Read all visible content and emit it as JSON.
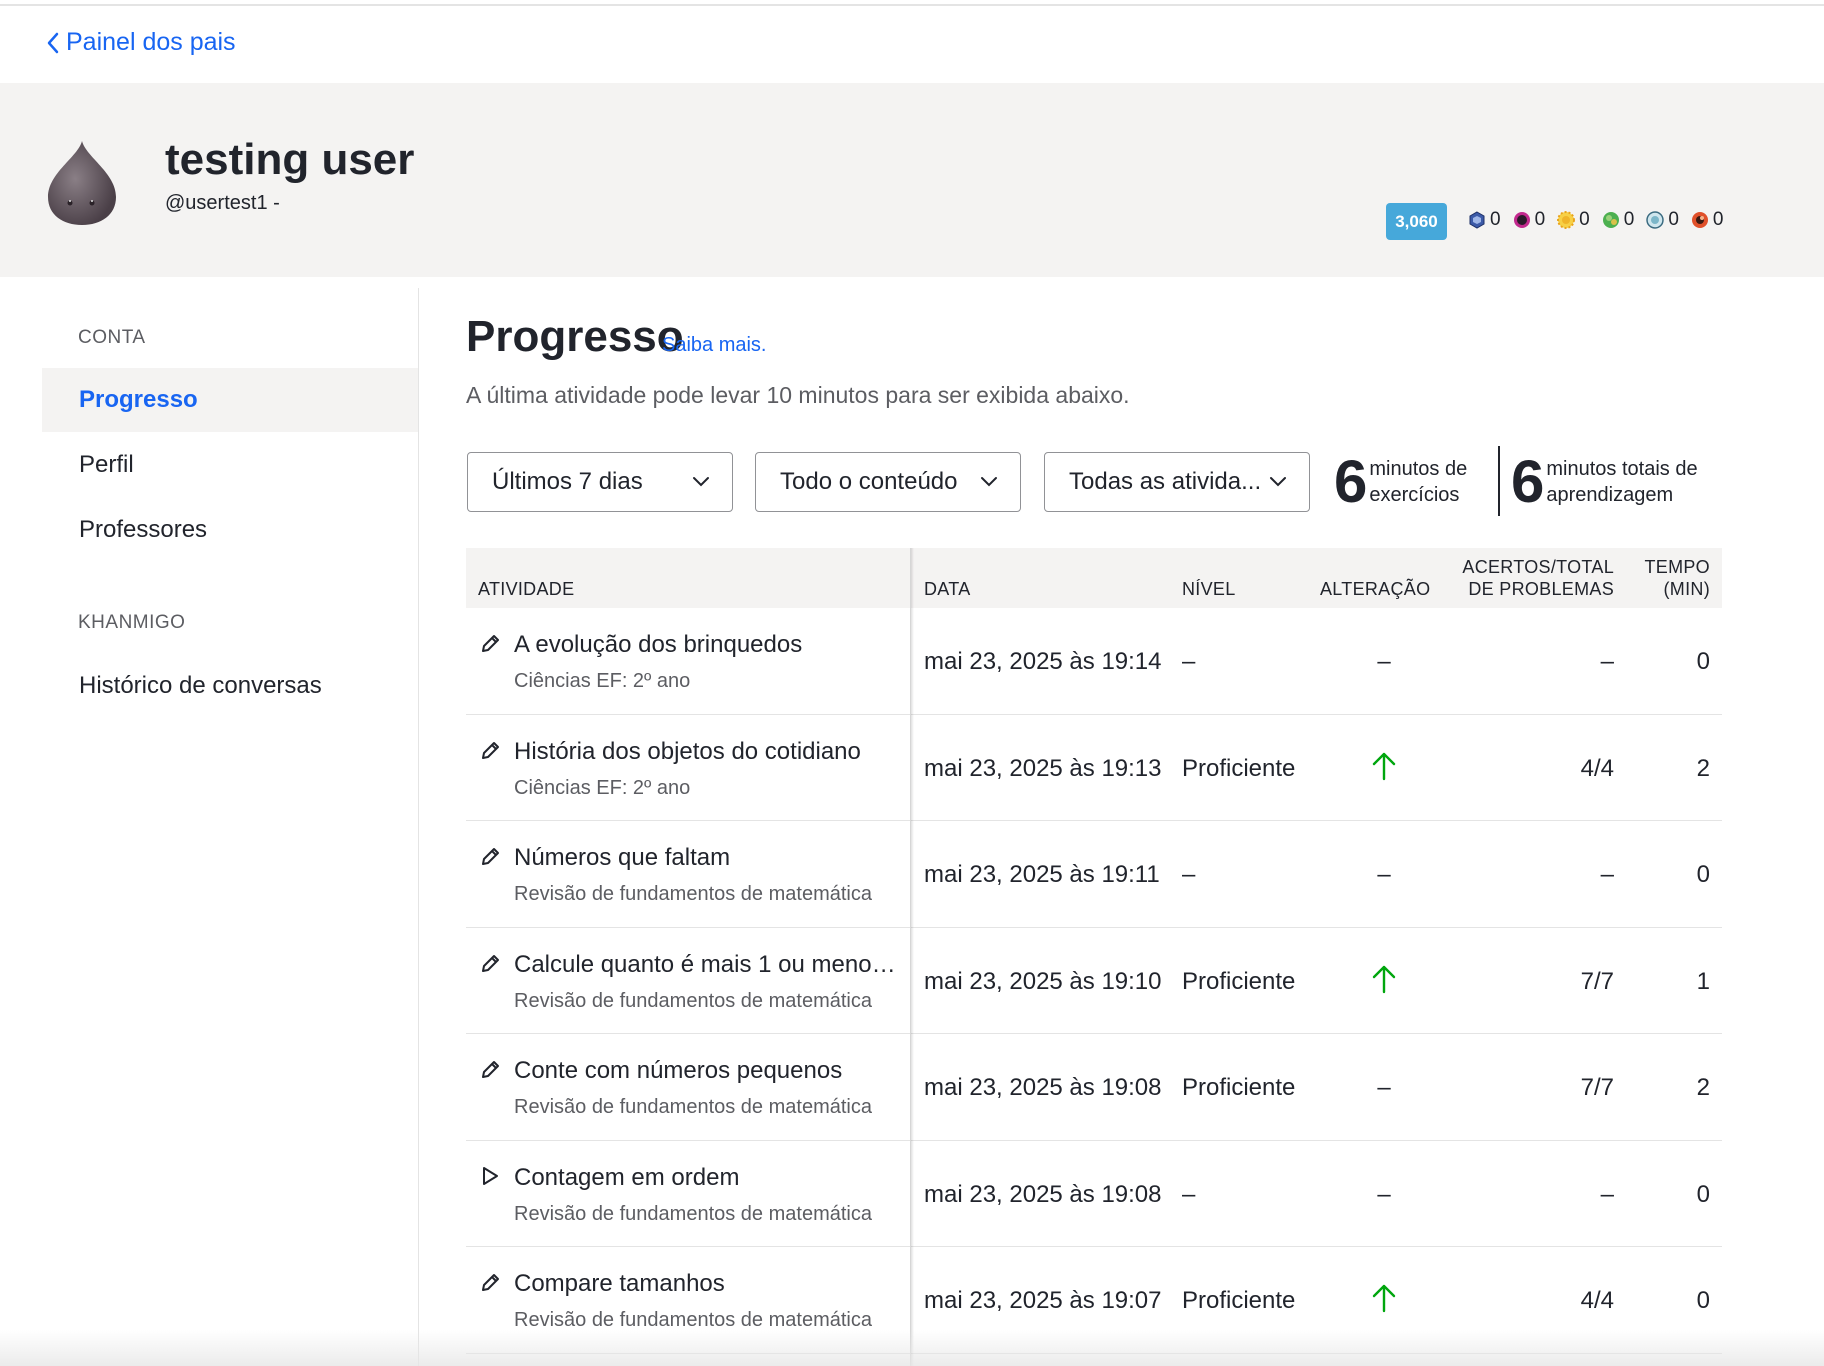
{
  "back_link": {
    "label": "Painel dos pais"
  },
  "header": {
    "name": "testing user",
    "handle": "@usertest1 -",
    "points": "3,060",
    "badges": [
      {
        "icon": "meteorite-badge-icon",
        "count": "0",
        "color": "#3c5aa8"
      },
      {
        "icon": "moon-badge-icon",
        "count": "0",
        "color": "#c2298e"
      },
      {
        "icon": "earth-badge-icon",
        "count": "0",
        "color": "#f0b429"
      },
      {
        "icon": "sun-badge-icon",
        "count": "0",
        "color": "#4caf50"
      },
      {
        "icon": "black-hole-badge-icon",
        "count": "0",
        "color": "#7bb6c9"
      },
      {
        "icon": "challenge-patch-icon",
        "count": "0",
        "color": "#e0502a"
      }
    ]
  },
  "sidebar": {
    "account_label": "CONTA",
    "items": [
      {
        "label": "Progresso",
        "active": true
      },
      {
        "label": "Perfil",
        "active": false
      },
      {
        "label": "Professores",
        "active": false
      }
    ],
    "khanmigo_label": "KHANMIGO",
    "khanmigo_items": [
      {
        "label": "Histórico de conversas"
      }
    ]
  },
  "main": {
    "title": "Progresso",
    "learn_more": "Saiba mais.",
    "subtitle": "A última atividade pode levar 10 minutos para ser exibida abaixo.",
    "filters": {
      "period": "Últimos 7 dias",
      "content": "Todo o conteúdo",
      "activities": "Todas as ativida..."
    },
    "stats": {
      "exercise_minutes": "6",
      "exercise_label_1": "minutos de",
      "exercise_label_2": "exercícios",
      "total_minutes": "6",
      "total_label_1": "minutos totais de",
      "total_label_2": "aprendizagem"
    }
  },
  "table": {
    "headers": {
      "activity": "ATIVIDADE",
      "date": "DATA",
      "level": "NÍVEL",
      "change": "ALTERAÇÃO",
      "score_1": "ACERTOS/TOTAL",
      "score_2": "DE PROBLEMAS",
      "time_1": "TEMPO",
      "time_2": "(MIN)"
    },
    "rows": [
      {
        "icon": "pencil-icon",
        "title": "A evolução dos brinquedos",
        "course": "Ciências EF: 2º ano",
        "date": "mai 23, 2025 às 19:14",
        "level": "–",
        "change": "–",
        "score": "–",
        "time": "0"
      },
      {
        "icon": "pencil-icon",
        "title": "História dos objetos do cotidiano",
        "course": "Ciências EF: 2º ano",
        "date": "mai 23, 2025 às 19:13",
        "level": "Proficiente",
        "change": "up",
        "score": "4/4",
        "time": "2"
      },
      {
        "icon": "pencil-icon",
        "title": "Números que faltam",
        "course": "Revisão de fundamentos de matemática",
        "date": "mai 23, 2025 às 19:11",
        "level": "–",
        "change": "–",
        "score": "–",
        "time": "0"
      },
      {
        "icon": "pencil-icon",
        "title": "Calcule quanto é mais 1 ou menos ...",
        "course": "Revisão de fundamentos de matemática",
        "date": "mai 23, 2025 às 19:10",
        "level": "Proficiente",
        "change": "up",
        "score": "7/7",
        "time": "1"
      },
      {
        "icon": "pencil-icon",
        "title": "Conte com números pequenos",
        "course": "Revisão de fundamentos de matemática",
        "date": "mai 23, 2025 às 19:08",
        "level": "Proficiente",
        "change": "–",
        "score": "7/7",
        "time": "2"
      },
      {
        "icon": "play-icon",
        "title": "Contagem em ordem",
        "course": "Revisão de fundamentos de matemática",
        "date": "mai 23, 2025 às 19:08",
        "level": "–",
        "change": "–",
        "score": "–",
        "time": "0"
      },
      {
        "icon": "pencil-icon",
        "title": "Compare tamanhos",
        "course": "Revisão de fundamentos de matemática",
        "date": "mai 23, 2025 às 19:07",
        "level": "Proficiente",
        "change": "up",
        "score": "4/4",
        "time": "0"
      }
    ]
  },
  "colors": {
    "link": "#1865f2",
    "up_arrow": "#00a60e",
    "header_band": "#f4f3f2"
  }
}
